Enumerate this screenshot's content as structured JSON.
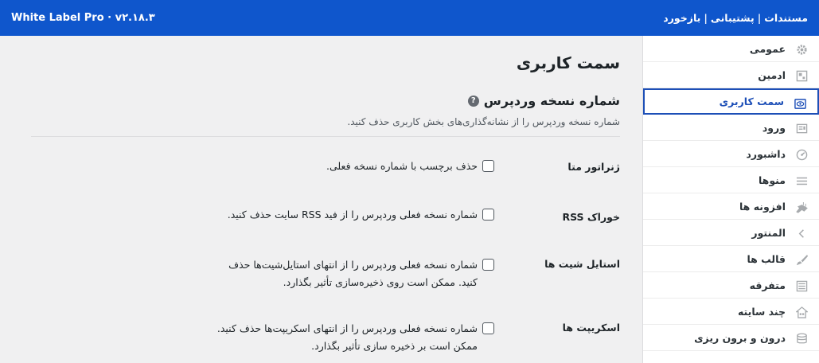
{
  "topbar": {
    "brand": "White Label Pro · v۲.۱۸.۳",
    "links": [
      "مستندات",
      "پشتیبانی",
      "بازخورد"
    ],
    "separator": "|"
  },
  "sidebar": {
    "items": [
      {
        "label": "عمومی",
        "icon": "gear-icon"
      },
      {
        "label": "ادمین",
        "icon": "admin-icon"
      },
      {
        "label": "سمت کاربری",
        "icon": "eye-icon"
      },
      {
        "label": "ورود",
        "icon": "login-icon"
      },
      {
        "label": "داشبورد",
        "icon": "dashboard-icon"
      },
      {
        "label": "منوها",
        "icon": "menu-icon"
      },
      {
        "label": "افزونه ها",
        "icon": "plugin-icon"
      },
      {
        "label": "المنتور",
        "icon": "elementor-icon"
      },
      {
        "label": "قالب ها",
        "icon": "brush-icon"
      },
      {
        "label": "متفرقه",
        "icon": "misc-icon"
      },
      {
        "label": "چند سایته",
        "icon": "multisite-icon"
      },
      {
        "label": "درون و برون ریزی",
        "icon": "database-icon"
      }
    ],
    "active_index": 2
  },
  "main": {
    "page_title": "سمت کاربری",
    "section_title": "شماره نسخه وردپرس",
    "help_glyph": "?",
    "section_desc": "شماره نسخه وردپرس را از نشانه‌گذاری‌های بخش کاربری حذف کنید.",
    "rows": [
      {
        "label": "ژنراتور متا",
        "text": "حذف برچسب با شماره نسخه فعلی.",
        "checked": false
      },
      {
        "label": "خوراک RSS",
        "text": "شماره نسخه فعلی وردپرس را از فید RSS سایت حذف کنید.",
        "checked": false
      },
      {
        "label": "استایل شیت ها",
        "text": "شماره نسخه فعلی وردپرس را از انتهای استایل‌شیت‌ها حذف کنید. ممکن است روی ذخیره‌سازی تأثیر بگذارد.",
        "checked": false
      },
      {
        "label": "اسکریپت ها",
        "text": "شماره نسخه فعلی وردپرس را از انتهای اسکریپت‌ها حذف کنید. ممکن است بر ذخیره سازی تأثیر بگذارد.",
        "checked": false
      }
    ]
  }
}
